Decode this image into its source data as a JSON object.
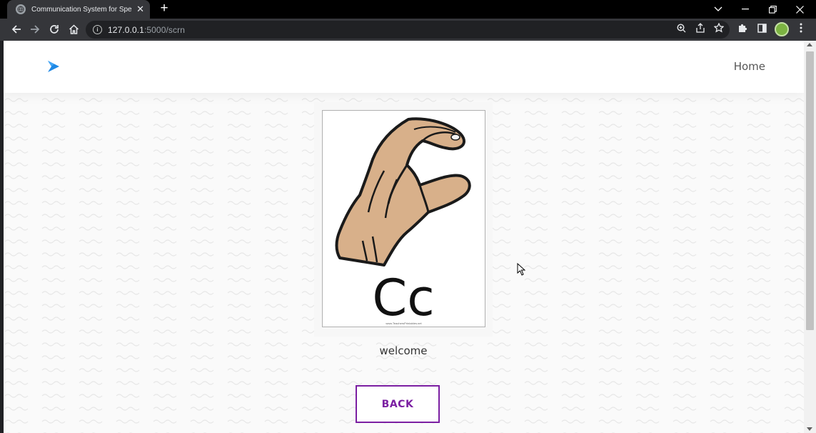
{
  "browser": {
    "tab_title": "Communication System for Specially",
    "url_host": "127.0.0.1",
    "url_path": ":5000/scrn",
    "icons": [
      "globe-icon",
      "close-icon",
      "plus-icon",
      "chevron-down-icon",
      "minimize-icon",
      "restore-icon",
      "close-window-icon",
      "back-arrow-icon",
      "forward-arrow-icon",
      "reload-icon",
      "home-icon",
      "info-icon",
      "zoom-icon",
      "share-icon",
      "star-icon",
      "extensions-icon",
      "side-panel-icon",
      "profile-avatar",
      "menu-dots-icon"
    ]
  },
  "navbar": {
    "logo_icon": "chevron-logo-icon",
    "logo_color": "#1e88e5",
    "home_label": "Home"
  },
  "main": {
    "sign_image": {
      "letters": "Cc",
      "credit": "www.TeachersPrintables.net"
    },
    "caption": "welcome",
    "back_button_label": "BACK",
    "accent_color": "#7b1fa2"
  }
}
